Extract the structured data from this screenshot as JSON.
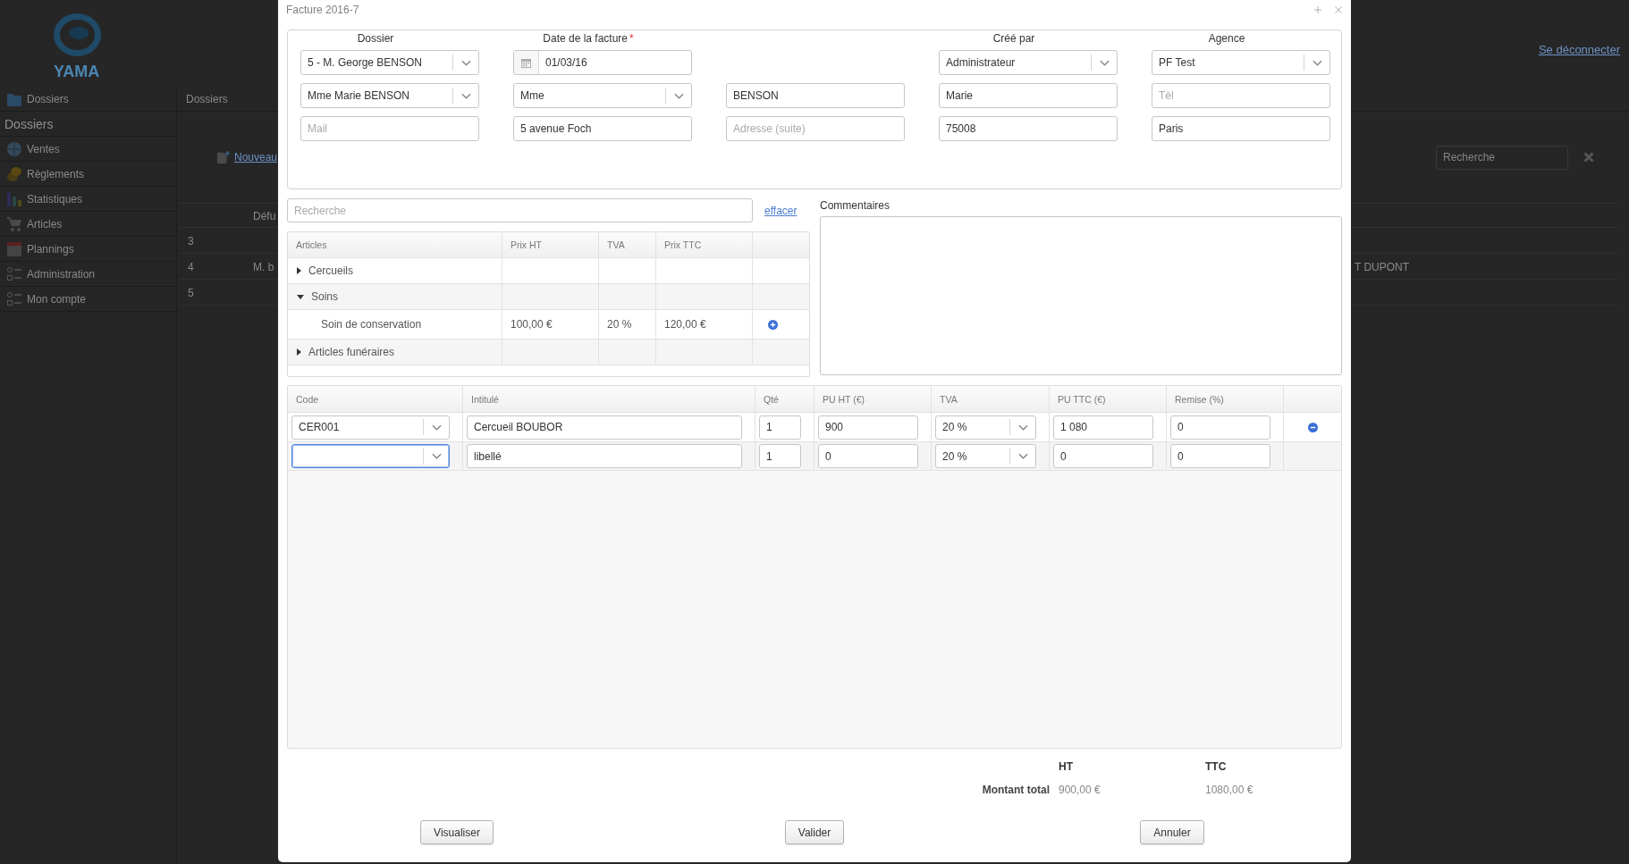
{
  "background": {
    "logo": {
      "text": "YAMA"
    },
    "logout_link": "Se déconnecter",
    "sidebar": [
      {
        "label": "Dossiers",
        "kind": "link"
      },
      {
        "label": "Dossiers",
        "kind": "heading"
      },
      {
        "label": "Ventes",
        "kind": "link"
      },
      {
        "label": "Règlements",
        "kind": "link"
      },
      {
        "label": "Statistiques",
        "kind": "link"
      },
      {
        "label": "Articles",
        "kind": "link"
      },
      {
        "label": "Plannings",
        "kind": "link"
      },
      {
        "label": "Administration",
        "kind": "link"
      },
      {
        "label": "Mon compte",
        "kind": "link"
      }
    ],
    "breadcrumb": "Dossiers",
    "new_link": "Nouveau",
    "search": {
      "placeholder": "Recherche"
    },
    "table": {
      "header": {
        "column_2": "Défu"
      },
      "rows": [
        {
          "column_1": "3"
        },
        {
          "column_1": "4",
          "column_2": "M. b",
          "column_3": "T DUPONT"
        },
        {
          "column_1": "5"
        }
      ]
    }
  },
  "dialog": {
    "title": "Facture 2016-7",
    "header_form": {
      "rows": [
        [
          {
            "label": "Dossier",
            "kind": "select",
            "value": "5 - M. George BENSON"
          },
          {
            "label": "Date de la facture",
            "required_mark": "*",
            "kind": "date",
            "value": "01/03/16"
          },
          "",
          {
            "label": "Créé par",
            "kind": "select",
            "value": "Administrateur"
          },
          {
            "label": "Agence",
            "kind": "select",
            "value": "PF Test"
          }
        ],
        [
          {
            "kind": "select",
            "value": "Mme Marie BENSON"
          },
          {
            "kind": "select",
            "value": "Mme"
          },
          {
            "kind": "text",
            "value": "BENSON"
          },
          {
            "kind": "text",
            "value": "Marie"
          },
          {
            "kind": "text",
            "placeholder": "Tèl"
          }
        ],
        [
          {
            "kind": "text",
            "placeholder": "Mail"
          },
          {
            "kind": "text",
            "value": "5 avenue Foch"
          },
          {
            "kind": "text",
            "placeholder": "Adresse (suite)"
          },
          {
            "kind": "text",
            "value": "75008"
          },
          {
            "kind": "text",
            "value": "Paris"
          }
        ]
      ]
    },
    "article_search": {
      "placeholder": "Recherche",
      "clear_link": "effacer"
    },
    "articles_table": {
      "columns": [
        "Articles",
        "Prix HT",
        "TVA",
        "Prix TTC"
      ],
      "groups": [
        {
          "name": "Cercueils",
          "expanded": false
        },
        {
          "name": "Soins",
          "expanded": true,
          "children": [
            {
              "name": "Soin de conservation",
              "prix_ht": "100,00 €",
              "tva": "20 %",
              "prix_ttc": "120,00 €"
            }
          ]
        },
        {
          "name": "Articles funéraires",
          "expanded": false
        }
      ]
    },
    "comments": {
      "label": "Commentaires"
    },
    "lines_table": {
      "columns": [
        "Code",
        "Intitulé",
        "Qté",
        "PU HT (€)",
        "TVA",
        "PU TTC (€)",
        "Remise (%)"
      ],
      "rows": [
        {
          "code": "CER001",
          "code_focused": false,
          "label": "Cercueil BOUBOR",
          "qty": "1",
          "pu_ht": "900",
          "tva": "20 %",
          "pu_ttc": "1 080",
          "discount": "0",
          "removable": true
        },
        {
          "code_focused": true,
          "label": "libellé",
          "qty": "1",
          "pu_ht": "0",
          "tva": "20 %",
          "pu_ttc": "0",
          "discount": "0",
          "removable": false
        }
      ]
    },
    "totals": {
      "headings": [
        "HT",
        "TTC"
      ],
      "label": "Montant total",
      "values": [
        "900,00 €",
        "1080,00 €"
      ]
    },
    "buttons": [
      "Visualiser",
      "Valider",
      "Annuler"
    ]
  }
}
